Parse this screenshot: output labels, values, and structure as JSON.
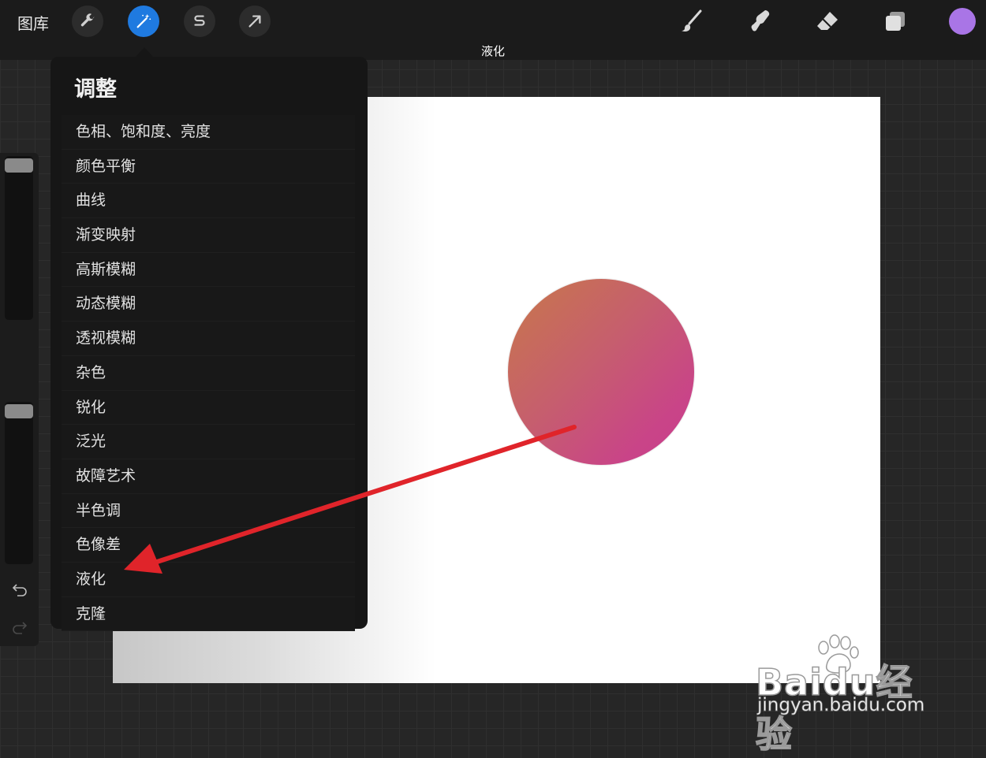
{
  "topbar": {
    "gallery_label": "图库",
    "left_tools": [
      {
        "icon": "wrench-icon",
        "active": false
      },
      {
        "icon": "magic-wand-icon",
        "active": true
      },
      {
        "icon": "selection-s-icon",
        "active": false
      },
      {
        "icon": "transform-arrow-icon",
        "active": false
      }
    ],
    "right_tools": [
      "brush-icon",
      "smudge-icon",
      "eraser-icon",
      "layers-icon"
    ],
    "current_color": "#a975e6",
    "active_accent": "#1f7ae0"
  },
  "caption": "液化",
  "adjustments_menu": {
    "title": "调整",
    "items": [
      "色相、饱和度、亮度",
      "颜色平衡",
      "曲线",
      "渐变映射",
      "高斯模糊",
      "动态模糊",
      "透视模糊",
      "杂色",
      "锐化",
      "泛光",
      "故障艺术",
      "半色调",
      "色像差",
      "液化",
      "克隆"
    ]
  },
  "sidebar": {
    "brush_size_icon": "slider-icon",
    "opacity_icon": "slider-icon",
    "undo_icon": "undo-icon",
    "redo_icon": "redo-icon"
  },
  "annotation_color": "#e0242a",
  "watermark": {
    "logo": "Baidu经验",
    "url": "jingyan.baidu.com"
  }
}
